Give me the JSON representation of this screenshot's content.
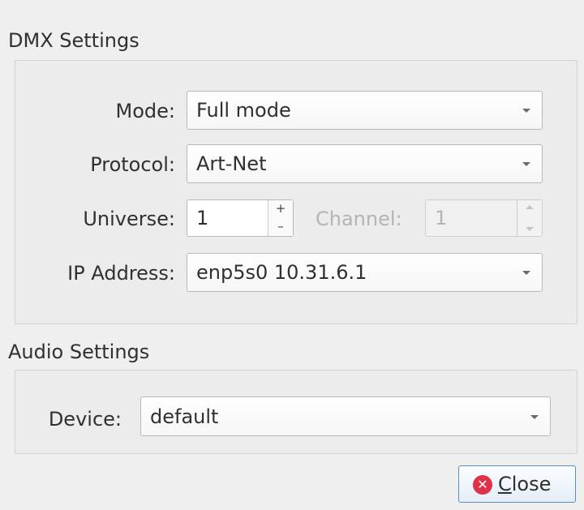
{
  "dmx": {
    "title": "DMX Settings",
    "mode": {
      "label": "Mode:",
      "value": "Full mode"
    },
    "protocol": {
      "label": "Protocol:",
      "value": "Art-Net"
    },
    "universe": {
      "label": "Universe:",
      "value": "1",
      "up": "+",
      "down": "–"
    },
    "channel": {
      "label": "Channel:",
      "value": "1"
    },
    "ip": {
      "label": "IP Address:",
      "value": "enp5s0 10.31.6.1"
    }
  },
  "audio": {
    "title": "Audio Settings",
    "device": {
      "label": "Device:",
      "value": "default"
    }
  },
  "close": {
    "icon": "✕",
    "mnemonic": "C",
    "rest": "lose"
  }
}
